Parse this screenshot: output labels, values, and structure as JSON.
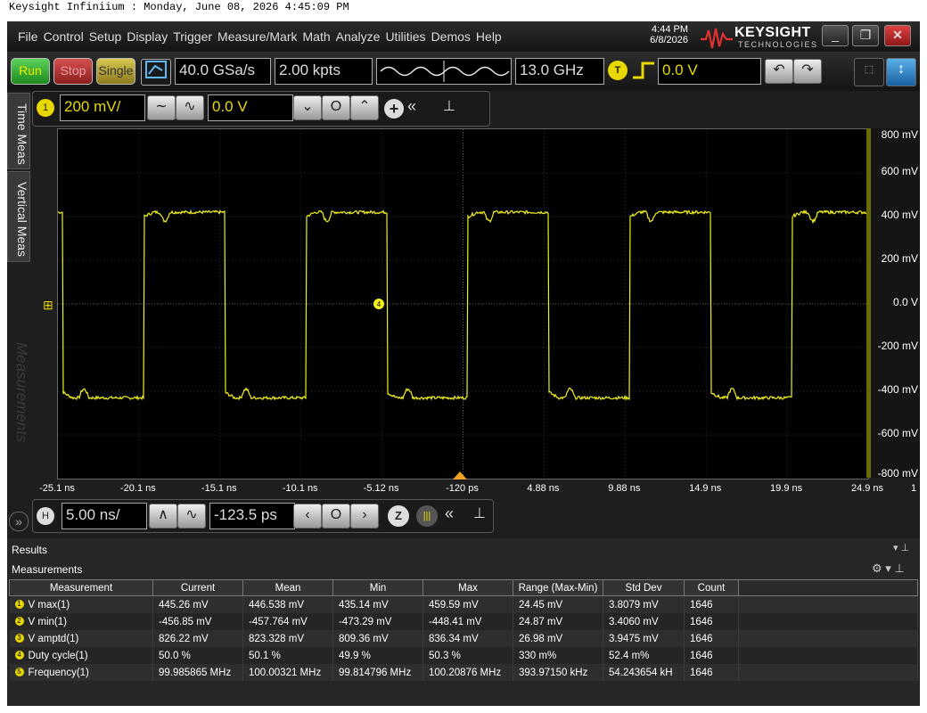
{
  "header_text": "Keysight Infiniium : Monday, June 08, 2026 4:45:09 PM",
  "menu": [
    "File",
    "Control",
    "Setup",
    "Display",
    "Trigger",
    "Measure/Mark",
    "Math",
    "Analyze",
    "Utilities",
    "Demos",
    "Help"
  ],
  "clock": {
    "time": "4:44 PM",
    "date": "6/8/2026"
  },
  "brand": {
    "name": "KEYSIGHT",
    "sub": "TECHNOLOGIES"
  },
  "toolbar": {
    "run": "Run",
    "stop": "Stop",
    "single": "Single",
    "sample_rate": "40.0 GSa/s",
    "points": "2.00 kpts",
    "bandwidth": "13.0 GHz",
    "trigger_badge": "T",
    "trigger_level": "0.0 V"
  },
  "tabs": {
    "time": "Time Meas",
    "vertical": "Vertical Meas",
    "watermark": "Measurements"
  },
  "channel": {
    "badge": "1",
    "scale": "200 mV/",
    "offset": "0.0 V"
  },
  "y_labels": [
    "800 mV",
    "600 mV",
    "400 mV",
    "200 mV",
    "0.0 V",
    "-200 mV",
    "-400 mV",
    "-600 mV",
    "-800 mV"
  ],
  "x_labels": [
    "-25.1 ns",
    "-20.1 ns",
    "-15.1 ns",
    "-10.1 ns",
    "-5.12 ns",
    "-120 ps",
    "4.88 ns",
    "9.88 ns",
    "14.9 ns",
    "19.9 ns",
    "24.9 ns"
  ],
  "x_edge_label": "1",
  "marker_label": "4",
  "timebase": {
    "badge": "H",
    "scale": "5.00 ns/",
    "position": "-123.5 ps"
  },
  "results": {
    "title": "Results",
    "subtitle": "Measurements",
    "columns": [
      "Measurement",
      "Current",
      "Mean",
      "Min",
      "Max",
      "Range (Max-Min)",
      "Std Dev",
      "Count"
    ],
    "rows": [
      {
        "n": "1",
        "name": "V max(1)",
        "cells": [
          "445.26 mV",
          "446.538 mV",
          "435.14 mV",
          "459.59 mV",
          "24.45 mV",
          "3.8079 mV",
          "1646"
        ]
      },
      {
        "n": "2",
        "name": "V min(1)",
        "cells": [
          "-456.85 mV",
          "-457.764 mV",
          "-473.29 mV",
          "-448.41 mV",
          "24.87 mV",
          "3.4060 mV",
          "1646"
        ]
      },
      {
        "n": "3",
        "name": "V amptd(1)",
        "cells": [
          "826.22 mV",
          "823.328 mV",
          "809.36 mV",
          "836.34 mV",
          "26.98 mV",
          "3.9475 mV",
          "1646"
        ]
      },
      {
        "n": "4",
        "name": "Duty cycle(1)",
        "cells": [
          "50.0 %",
          "50.1 %",
          "49.9 %",
          "50.3 %",
          "330 m%",
          "52.4 m%",
          "1646"
        ]
      },
      {
        "n": "5",
        "name": "Frequency(1)",
        "cells": [
          "99.985865 MHz",
          "100.00321 MHz",
          "99.814796 MHz",
          "100.20876 MHz",
          "393.97150 kHz",
          "54.243654 kH",
          "1646"
        ]
      }
    ]
  },
  "colors": {
    "trace": "#f2f21a",
    "bg": "#000000",
    "run": "#2ea82e",
    "stop": "#c03030",
    "single": "#c8b428"
  }
}
